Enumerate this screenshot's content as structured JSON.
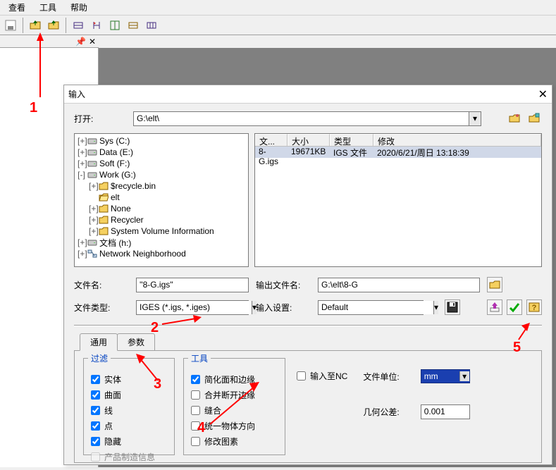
{
  "menu": {
    "view": "查看",
    "tools": "工具",
    "help": "帮助"
  },
  "dialog": {
    "title": "输入",
    "open_label": "打开:",
    "open_value": "G:\\elt\\",
    "filename_label": "文件名:",
    "filename_value": "''8-G.igs''",
    "output_label": "输出文件名:",
    "output_value": "G:\\elt\\8-G",
    "filetype_label": "文件类型:",
    "filetype_value": "IGES (*.igs, *.iges)",
    "insettings_label": "输入设置:",
    "insettings_value": "Default"
  },
  "tree": [
    {
      "indent": 0,
      "tw": "+",
      "icon": "drive",
      "label": "Sys (C:)"
    },
    {
      "indent": 0,
      "tw": "+",
      "icon": "drive",
      "label": "Data (E:)"
    },
    {
      "indent": 0,
      "tw": "+",
      "icon": "drive",
      "label": "Soft (F:)"
    },
    {
      "indent": 0,
      "tw": "-",
      "icon": "drive",
      "label": "Work (G:)"
    },
    {
      "indent": 1,
      "tw": "+",
      "icon": "folder",
      "label": "$recycle.bin"
    },
    {
      "indent": 1,
      "tw": "",
      "icon": "folder-open",
      "label": "elt"
    },
    {
      "indent": 1,
      "tw": "+",
      "icon": "folder",
      "label": "None"
    },
    {
      "indent": 1,
      "tw": "+",
      "icon": "folder",
      "label": "Recycler"
    },
    {
      "indent": 1,
      "tw": "+",
      "icon": "folder",
      "label": "System Volume Information"
    },
    {
      "indent": 0,
      "tw": "+",
      "icon": "drive",
      "label": "文档 (h:)"
    },
    {
      "indent": 0,
      "tw": "+",
      "icon": "net",
      "label": "Network Neighborhood"
    }
  ],
  "list": {
    "cols": {
      "name": "文...",
      "size": "大小",
      "type": "类型",
      "mod": "修改"
    },
    "rows": [
      {
        "name": "8-G.igs",
        "size": "19671KB",
        "type": "IGS 文件",
        "mod": "2020/6/21/周日 13:18:39"
      }
    ]
  },
  "tabs": {
    "general": "通用",
    "params": "参数"
  },
  "filter": {
    "title": "过滤",
    "solid": "实体",
    "surface": "曲面",
    "curve": "线",
    "point": "点",
    "hidden": "隐藏",
    "pmi": "产品制造信息"
  },
  "tools": {
    "title": "工具",
    "simpl": "简化面和边缘",
    "stitchbreak": "合并断开边缘",
    "sew": "缝合",
    "unify": "统一物体方向",
    "fix": "修改图素"
  },
  "inc": "输入至NC",
  "unit_label": "文件单位:",
  "unit_value": "mm",
  "tol_label": "几何公差:",
  "tol_value": "0.001",
  "anno": {
    "1": "1",
    "2": "2",
    "3": "3",
    "4": "4",
    "5": "5"
  }
}
